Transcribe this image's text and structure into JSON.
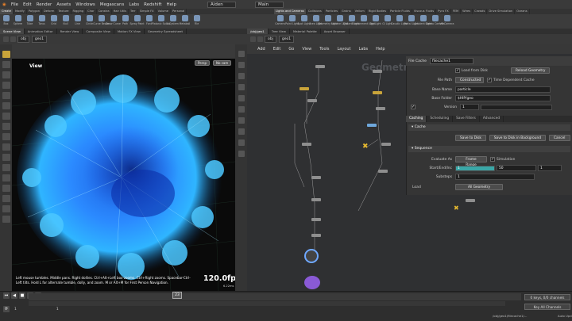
{
  "menubar": {
    "items": [
      "File",
      "Edit",
      "Render",
      "Assets",
      "Windows",
      "Megascans",
      "Labs",
      "Redshift",
      "Help"
    ],
    "desktop": "Aiden",
    "main": "Main"
  },
  "shelf_tabs_left": [
    "Create",
    "Modify",
    "Polygon",
    "Deform",
    "Texture",
    "Rigging",
    "Char",
    "Constra",
    "Hair Utils",
    "Terr",
    "Simple FX",
    "Volume",
    "Personal"
  ],
  "shelf_tabs_right": [
    "Lights and Cameras",
    "Collisions",
    "Particles",
    "Grains",
    "Vellum",
    "Rigid Bodies",
    "Particle Fluids",
    "Viscous Fluids",
    "Pyro FX",
    "FEM",
    "Wires",
    "Crowds",
    "Drive Simulation",
    "Oceans"
  ],
  "tools_left": [
    "Box",
    "Sphere",
    "Tube",
    "Torus",
    "Grid",
    "Null",
    "Line",
    "Circle",
    "Curve Bezier",
    "Draw Curve",
    "Path",
    "Spray Paint",
    "Font",
    "Platonic Solids",
    "L-System",
    "Metaball",
    "File"
  ],
  "tools_right": [
    "Camera",
    "Point Light",
    "Spot Light",
    "Area Light",
    "Geometry Light",
    "Volume Light",
    "Distant Light",
    "Environment Light",
    "Sky Light",
    "GI Light",
    "Caustic Light",
    "Portal Light",
    "Ambient Light",
    "Stereo Camera",
    "VR Camera"
  ],
  "pane_tabs_left": [
    "Scene View",
    "Animation Editor",
    "Render View",
    "Composite View",
    "Motion FX View",
    "Geometry Spreadsheet"
  ],
  "pane_tabs_right": [
    "/obj/geo1",
    "Tree View",
    "Material Palette",
    "Asset Browser"
  ],
  "path_left": [
    "obj",
    "geo1"
  ],
  "path_right": [
    "obj",
    "geo1"
  ],
  "viewport": {
    "label": "View",
    "persp": "Persp",
    "cam": "No cam",
    "hint": "Left mouse tumbles. Middle pans. Right dollies. Ctrl+Alt+Left box-zooms. Ctrl+Right zooms. Spacebar-Ctrl-Left tilts. Hold L for alternate tumble, dolly, and zoom. M or Alt+M for First Person Navigation.",
    "fps": "120.0fps",
    "ms": "6.22ms"
  },
  "network": {
    "menu": [
      "Add",
      "Edit",
      "Go",
      "View",
      "Tools",
      "Layout",
      "Labs",
      "Help"
    ],
    "watermark": "Geometry"
  },
  "params": {
    "node_type": "File Cache",
    "node_name": "filecache1",
    "load_from_disk": "Load from Disk",
    "reload_geometry": "Reload Geometry",
    "file_path_label": "File Path",
    "file_path_value": "Constructed",
    "time_dependent": "Time Dependent Cache",
    "base_name_label": "Base Name",
    "base_name_value": "particle",
    "base_folder_label": "Base Folder",
    "base_folder_value": "$HIP/geo",
    "version_label": "Version",
    "version_value": "1",
    "tabs": [
      "Caching",
      "Scheduling",
      "Save Filters",
      "Advanced"
    ],
    "cache_section": "Cache",
    "save_to_disk": "Save to Disk",
    "save_bg": "Save to Disk in Background",
    "cancel": "Cancel",
    "sequence_section": "Sequence",
    "evaluate_label": "Evaluate As",
    "evaluate_value": "Frame Range",
    "simulation": "Simulation",
    "startend_label": "Start/End/Inc",
    "start": "1",
    "end": "50",
    "inc": "1",
    "substeps_label": "Substeps",
    "substeps": "1",
    "load_section": "Load",
    "all_geometry": "All Geometry"
  },
  "timeline": {
    "frame": "23",
    "playhead": "23",
    "start": "1",
    "end_start": "1",
    "keys": "0 keys, 0/0 channels",
    "all_channels": "Key All Channels",
    "status": "/obj/geo1/filecache1/...",
    "auto": "Auto Upd"
  },
  "colors": {
    "accent_yellow": "#c9a43a",
    "node_teal": "#3aa7a7",
    "cloud_blue": "#2f7fff"
  }
}
